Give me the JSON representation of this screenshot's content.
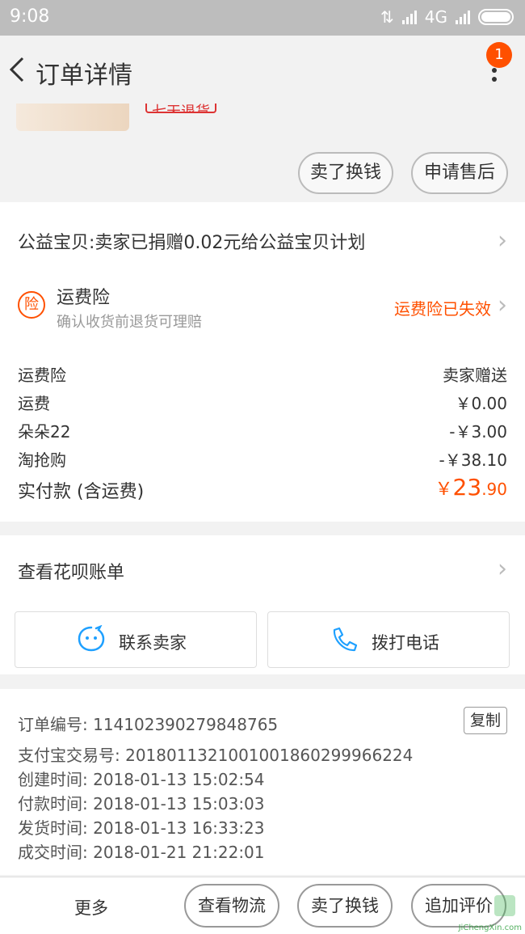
{
  "status_bar": {
    "time": "9:08",
    "network": "4G"
  },
  "header": {
    "title": "订单详情",
    "badge_count": "1"
  },
  "product": {
    "tag_text": "七天退货",
    "sell_button": "卖了换钱",
    "after_sale_button": "申请售后"
  },
  "charity": {
    "text": "公益宝贝:卖家已捐赠0.02元给公益宝贝计划"
  },
  "insurance": {
    "icon_char": "险",
    "title": "运费险",
    "subtitle": "确认收货前退货可理赔",
    "status": "运费险已失效"
  },
  "fees": [
    {
      "label": "运费险",
      "value": "卖家赠送"
    },
    {
      "label": "运费",
      "value": "￥0.00"
    },
    {
      "label": "朵朵22",
      "value": "-￥3.00"
    },
    {
      "label": "淘抢购",
      "value": "-￥38.10"
    }
  ],
  "total": {
    "label": "实付款 (含运费)",
    "currency": "￥",
    "integer": "23",
    "decimal": ".90"
  },
  "huabei": {
    "label": "查看花呗账单"
  },
  "contact": {
    "seller_label": "联系卖家",
    "phone_label": "拨打电话"
  },
  "order_info": {
    "rows": [
      "订单编号: 114102390279848765",
      "支付宝交易号: 2018011321001001860299966224",
      "创建时间: 2018-01-13 15:02:54",
      "付款时间: 2018-01-13 15:03:03",
      "发货时间: 2018-01-13 16:33:23",
      "成交时间: 2018-01-21 21:22:01"
    ],
    "copy_button": "复制"
  },
  "bottom_bar": {
    "more": "更多",
    "logistics": "查看物流",
    "sell": "卖了换钱",
    "review": "追加评价"
  },
  "watermark": "JiChengXin.com",
  "colors": {
    "accent": "#ff5000",
    "icon_blue": "#1ea0ff",
    "page_bg": "#f2f2f2"
  }
}
